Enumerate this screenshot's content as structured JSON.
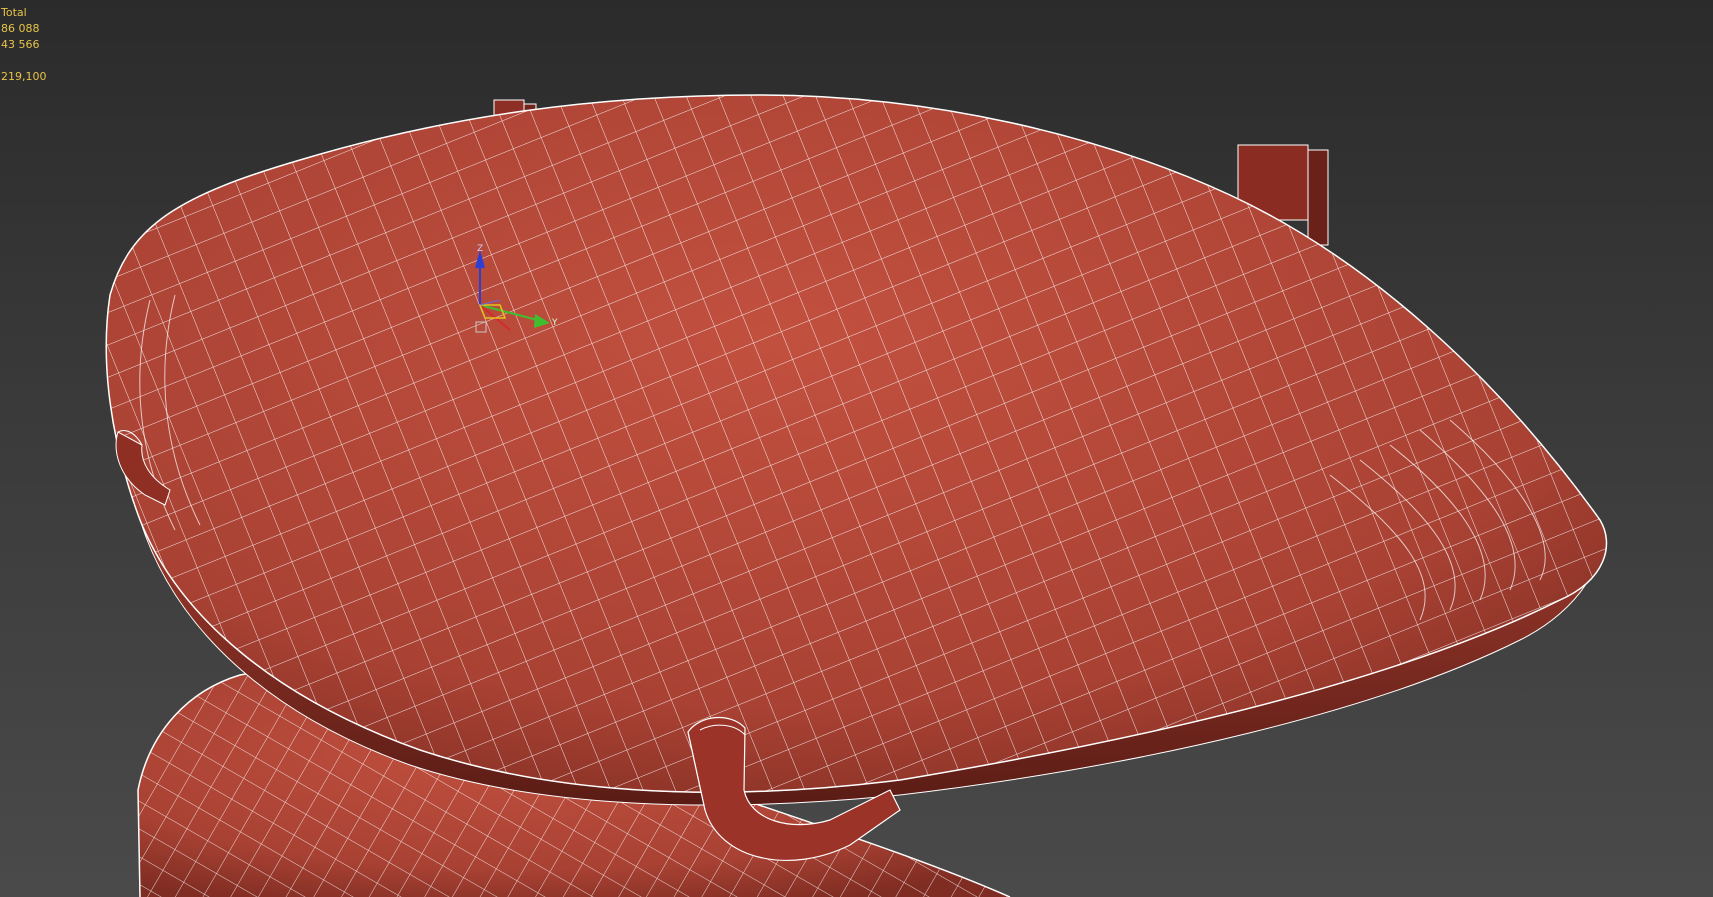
{
  "viewport": {
    "stats": {
      "label": "Total",
      "polys": "86 088",
      "verts": "43 566",
      "fps": "219,100"
    },
    "gizmo": {
      "axis_z": "Z",
      "axis_y": "Y",
      "colors": {
        "z": "#2b3fd6",
        "y": "#3fbf2f",
        "x": "#d62b2b",
        "plane": "#e3c21d"
      }
    },
    "colors": {
      "mesh": "#b5483a",
      "wire": "#ffffff",
      "background_top": "#2b2b2b",
      "background_bottom": "#4a4a4a"
    }
  }
}
